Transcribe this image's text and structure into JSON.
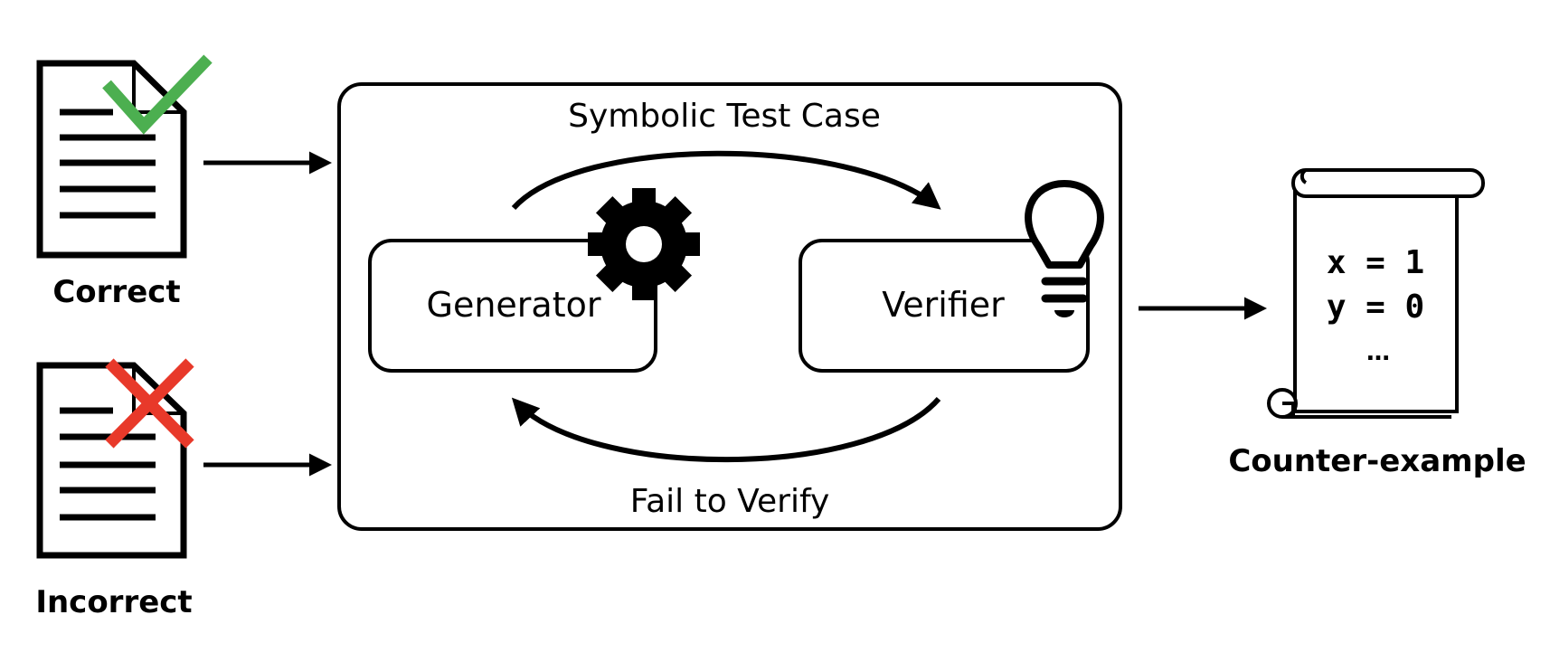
{
  "inputs": {
    "correct": {
      "label": "Correct",
      "mark_icon": "checkmark-icon",
      "mark_color": "#4caf50"
    },
    "incorrect": {
      "label": "Incorrect",
      "mark_icon": "cross-icon",
      "mark_color": "#e8392a"
    }
  },
  "loop": {
    "top_label": "Symbolic Test Case",
    "bottom_label": "Fail to Verify",
    "generator": {
      "label": "Generator",
      "icon": "gear-icon"
    },
    "verifier": {
      "label": "Verifier",
      "icon": "lightbulb-icon"
    }
  },
  "output": {
    "label": "Counter-example",
    "icon": "scroll-icon",
    "lines": [
      "x = 1",
      "y = 0",
      "…"
    ]
  }
}
